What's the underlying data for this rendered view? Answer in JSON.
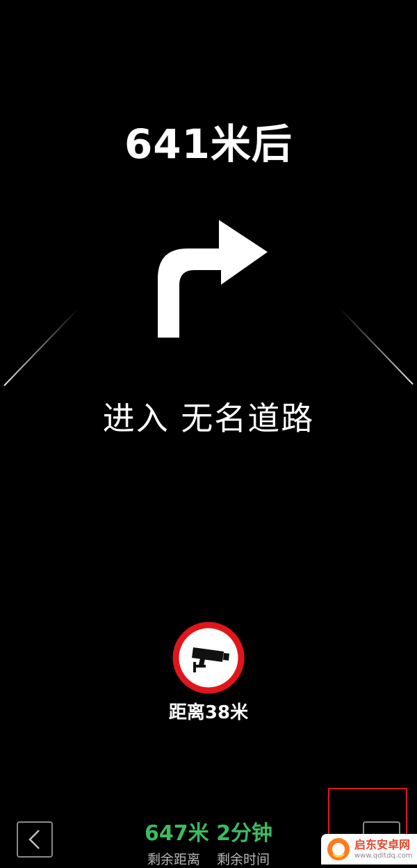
{
  "navigation": {
    "distance_to_turn": "641米后",
    "maneuver_icon": "turn-right-arrow-icon",
    "road_instruction": "进入 无名道路",
    "camera": {
      "icon": "speed-camera-icon",
      "distance_text": "距离38米",
      "sign_border_color": "#e0161b"
    }
  },
  "bottom_bar": {
    "back_icon": "chevron-left-icon",
    "remaining_distance": "647米",
    "remaining_time": "2分钟",
    "remaining_distance_label": "剩余距离",
    "remaining_time_label": "剩余时间",
    "value_color": "#3dbb5f"
  },
  "watermark": {
    "name": "启东安卓网",
    "url": "www.qdltdq.com"
  }
}
